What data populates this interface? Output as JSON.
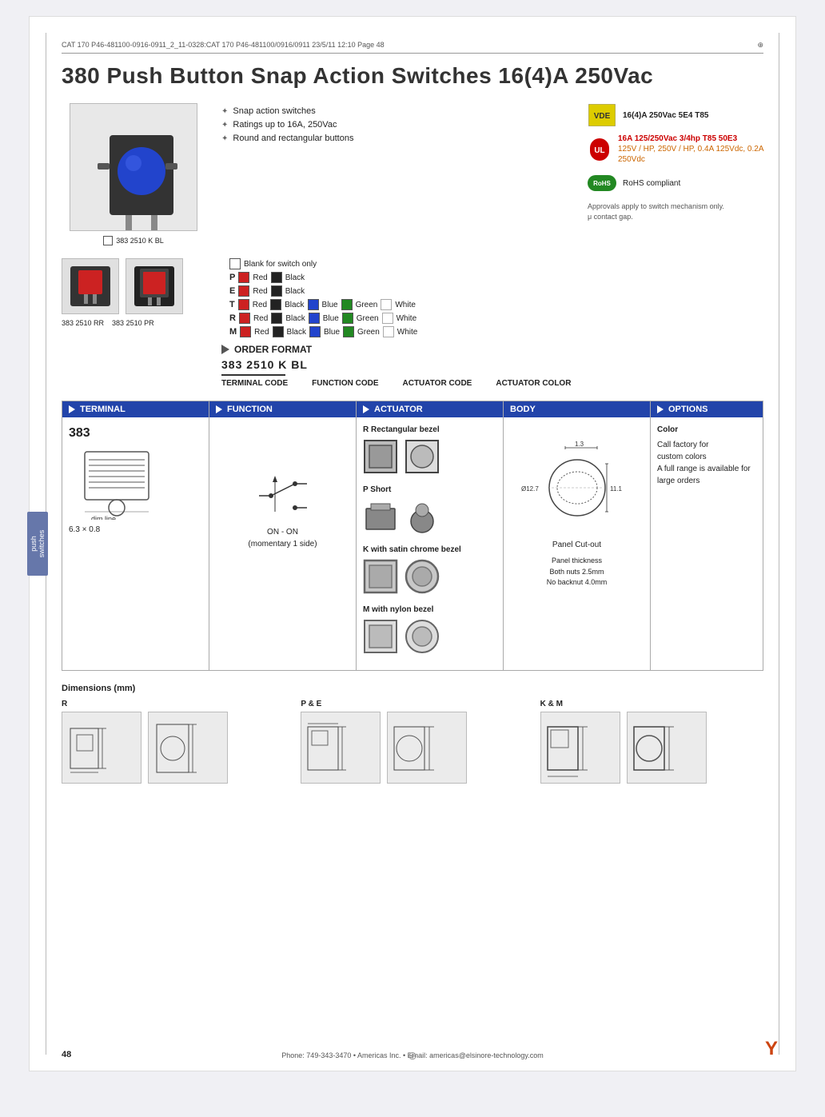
{
  "page": {
    "top_bar": "CAT 170 P46-481100-0916-0911_2_11-0328:CAT 170 P46-481100/0916/0911  23/5/11  12:10  Page 48",
    "page_number": "48",
    "footer_text": "Phone: 749-343-3470 • Americas Inc. • Email: americas@elsinore-technology.com"
  },
  "title": "380 Push Button Snap Action Switches 16(4)A 250Vac",
  "product_image_label": "383 2510 K BL",
  "features": [
    "Snap action switches",
    "Ratings up to 16A, 250Vac",
    "Round and rectangular buttons"
  ],
  "certifications": {
    "vde": {
      "label": "16(4)A 250Vac 5E4 T85"
    },
    "ul": {
      "label": "16A 125/250Vac 3/4hp T85 50E3"
    },
    "ul_extra": "125V / HP, 250V / HP, 0.4A 125Vdc, 0.2A 250Vdc",
    "rohs_label": "RoHS compliant",
    "approvals_note": "Approvals apply to switch mechanism only.\nμ contact gap."
  },
  "second_product": {
    "labels": [
      "383 2510 RR",
      "383 2510 PR"
    ]
  },
  "color_table": {
    "rows": [
      {
        "prefix": "",
        "desc": "Blank for switch only"
      },
      {
        "prefix": "P",
        "colors": [
          "Red",
          "Black"
        ]
      },
      {
        "prefix": "E",
        "colors": [
          "Red",
          "Black"
        ]
      },
      {
        "prefix": "T",
        "colors": [
          "Red",
          "Black",
          "Blue",
          "Green",
          "White"
        ]
      },
      {
        "prefix": "R",
        "colors": [
          "Red",
          "Black",
          "Blue",
          "Green",
          "White"
        ]
      },
      {
        "prefix": "M",
        "colors": [
          "Red",
          "Black",
          "Blue",
          "Green",
          "White"
        ]
      }
    ]
  },
  "order_format": {
    "title": "ORDER FORMAT",
    "part_number": "383 2510 K BL",
    "codes": [
      "TERMINAL CODE",
      "FUNCTION CODE",
      "ACTUATOR CODE",
      "ACTUATOR COLOR"
    ]
  },
  "columns": {
    "terminal": {
      "header": "TERMINAL",
      "code": "383",
      "dimension": "6.3 × 0.8"
    },
    "function": {
      "header": "FUNCTION",
      "label": "ON - ON\n(momentary 1 side)"
    },
    "actuator": {
      "header": "ACTUATOR",
      "items": [
        {
          "code": "R",
          "desc": "Rectangular bezel"
        },
        {
          "code": "P",
          "desc": "Short"
        },
        {
          "code": "K",
          "desc": "with satin chrome bezel"
        },
        {
          "code": "M",
          "desc": "with nylon bezel"
        }
      ]
    },
    "body": {
      "header": "BODY",
      "diameter": "Ø12.7",
      "dim1": "1.3",
      "dim2": "11.1",
      "panel_cutout": "Panel Cut-out",
      "panel_thickness": "Panel thickness\nBoth nuts 2.5mm\nNo backnut 4.0mm"
    },
    "options": {
      "header": "OPTIONS",
      "color_title": "Color",
      "color_desc": "Call factory for custom colors\nA full range is available for large orders"
    }
  },
  "dimensions": {
    "title": "Dimensions (mm)",
    "groups": [
      {
        "label": "R"
      },
      {
        "label": "P & E"
      },
      {
        "label": "K & M"
      }
    ]
  }
}
